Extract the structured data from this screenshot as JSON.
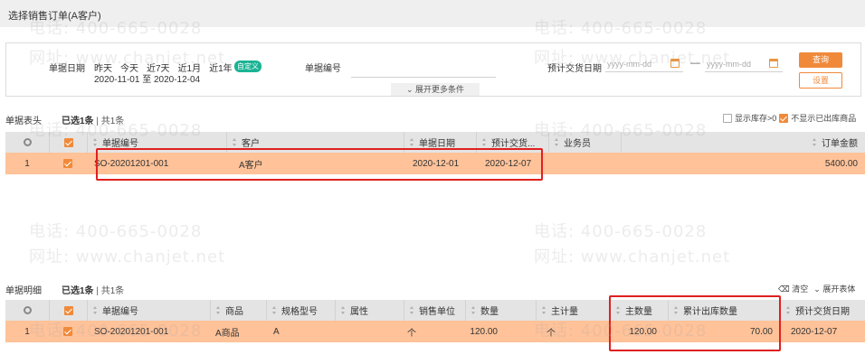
{
  "window": {
    "title": "选择销售订单(A客户)"
  },
  "filter": {
    "doc_date_label": "单据日期",
    "quick_ranges": [
      "昨天",
      "今天",
      "近7天",
      "近1月",
      "近1年"
    ],
    "custom_label": "自定义",
    "range_text": "2020-11-01 至 2020-12-04",
    "doc_no_label": "单据编号",
    "delivery_label": "预计交货日期",
    "date_placeholder": "yyyy-mm-dd",
    "separator": "—",
    "query_button": "查询",
    "settings_button": "设置",
    "expand_label": "展开更多条件"
  },
  "header_section": {
    "title": "单据表头",
    "selected": "已选1条",
    "total": "共1条",
    "show_stock_label": "显示库存>0",
    "hide_shipped_label": "不显示已出库商品",
    "columns": [
      "单据编号",
      "客户",
      "单据日期",
      "预计交货...",
      "业务员",
      "订单金额"
    ],
    "rows": [
      {
        "index": "1",
        "doc_no": "SO-20201201-001",
        "customer": "A客户",
        "date": "2020-12-01",
        "delivery": "2020-12-07",
        "salesman": "",
        "amount": "5400.00"
      }
    ]
  },
  "detail_section": {
    "title": "单据明细",
    "selected": "已选1条",
    "total": "共1条",
    "clear_label": "清空",
    "expand_header_label": "展开表体",
    "columns": [
      "单据编号",
      "商品",
      "规格型号",
      "属性",
      "销售单位",
      "数量",
      "主计量",
      "主数量",
      "累计出库数量",
      "预计交货日期"
    ],
    "rows": [
      {
        "index": "1",
        "doc_no": "SO-20201201-001",
        "product": "A商品",
        "spec": "A",
        "attr": "",
        "unit": "个",
        "qty": "120.00",
        "main_unit": "个",
        "main_qty": "120.00",
        "shipped_qty": "70.00",
        "delivery": "2020-12-07"
      }
    ]
  },
  "watermark": {
    "phone": "电话: 400-665-0028",
    "site": "网址: www.chanjet.net"
  }
}
